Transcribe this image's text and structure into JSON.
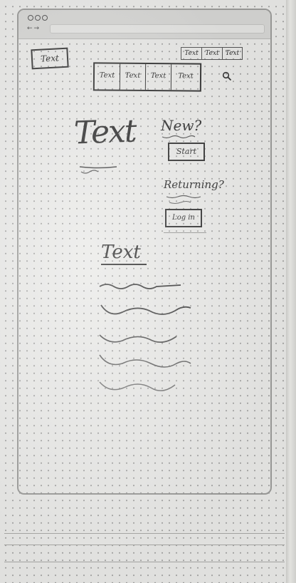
{
  "header": {
    "logo_label": "Text",
    "top_links": [
      "Text",
      "Text",
      "Text"
    ],
    "menu_items": [
      "Text",
      "Text",
      "Text",
      "Text"
    ],
    "search_icon": "search-icon"
  },
  "hero": {
    "title": "Text"
  },
  "auth": {
    "new_label": "New?",
    "start_button": "Start",
    "returning_label": "Returning?",
    "login_button": "Log in"
  },
  "content": {
    "section_heading": "Text"
  }
}
